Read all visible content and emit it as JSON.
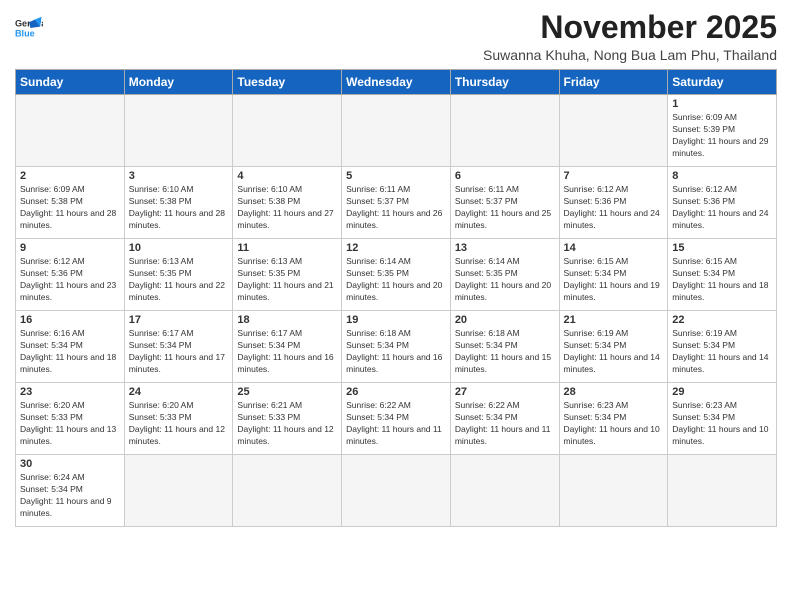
{
  "logo": {
    "line1": "General",
    "line2": "Blue"
  },
  "header": {
    "month_title": "November 2025",
    "subtitle": "Suwanna Khuha, Nong Bua Lam Phu, Thailand"
  },
  "weekdays": [
    "Sunday",
    "Monday",
    "Tuesday",
    "Wednesday",
    "Thursday",
    "Friday",
    "Saturday"
  ],
  "days": {
    "d1": {
      "num": "1",
      "sunrise": "6:09 AM",
      "sunset": "5:39 PM",
      "daylight": "11 hours and 29 minutes."
    },
    "d2": {
      "num": "2",
      "sunrise": "6:09 AM",
      "sunset": "5:38 PM",
      "daylight": "11 hours and 28 minutes."
    },
    "d3": {
      "num": "3",
      "sunrise": "6:10 AM",
      "sunset": "5:38 PM",
      "daylight": "11 hours and 28 minutes."
    },
    "d4": {
      "num": "4",
      "sunrise": "6:10 AM",
      "sunset": "5:38 PM",
      "daylight": "11 hours and 27 minutes."
    },
    "d5": {
      "num": "5",
      "sunrise": "6:11 AM",
      "sunset": "5:37 PM",
      "daylight": "11 hours and 26 minutes."
    },
    "d6": {
      "num": "6",
      "sunrise": "6:11 AM",
      "sunset": "5:37 PM",
      "daylight": "11 hours and 25 minutes."
    },
    "d7": {
      "num": "7",
      "sunrise": "6:12 AM",
      "sunset": "5:36 PM",
      "daylight": "11 hours and 24 minutes."
    },
    "d8": {
      "num": "8",
      "sunrise": "6:12 AM",
      "sunset": "5:36 PM",
      "daylight": "11 hours and 24 minutes."
    },
    "d9": {
      "num": "9",
      "sunrise": "6:12 AM",
      "sunset": "5:36 PM",
      "daylight": "11 hours and 23 minutes."
    },
    "d10": {
      "num": "10",
      "sunrise": "6:13 AM",
      "sunset": "5:35 PM",
      "daylight": "11 hours and 22 minutes."
    },
    "d11": {
      "num": "11",
      "sunrise": "6:13 AM",
      "sunset": "5:35 PM",
      "daylight": "11 hours and 21 minutes."
    },
    "d12": {
      "num": "12",
      "sunrise": "6:14 AM",
      "sunset": "5:35 PM",
      "daylight": "11 hours and 20 minutes."
    },
    "d13": {
      "num": "13",
      "sunrise": "6:14 AM",
      "sunset": "5:35 PM",
      "daylight": "11 hours and 20 minutes."
    },
    "d14": {
      "num": "14",
      "sunrise": "6:15 AM",
      "sunset": "5:34 PM",
      "daylight": "11 hours and 19 minutes."
    },
    "d15": {
      "num": "15",
      "sunrise": "6:15 AM",
      "sunset": "5:34 PM",
      "daylight": "11 hours and 18 minutes."
    },
    "d16": {
      "num": "16",
      "sunrise": "6:16 AM",
      "sunset": "5:34 PM",
      "daylight": "11 hours and 18 minutes."
    },
    "d17": {
      "num": "17",
      "sunrise": "6:17 AM",
      "sunset": "5:34 PM",
      "daylight": "11 hours and 17 minutes."
    },
    "d18": {
      "num": "18",
      "sunrise": "6:17 AM",
      "sunset": "5:34 PM",
      "daylight": "11 hours and 16 minutes."
    },
    "d19": {
      "num": "19",
      "sunrise": "6:18 AM",
      "sunset": "5:34 PM",
      "daylight": "11 hours and 16 minutes."
    },
    "d20": {
      "num": "20",
      "sunrise": "6:18 AM",
      "sunset": "5:34 PM",
      "daylight": "11 hours and 15 minutes."
    },
    "d21": {
      "num": "21",
      "sunrise": "6:19 AM",
      "sunset": "5:34 PM",
      "daylight": "11 hours and 14 minutes."
    },
    "d22": {
      "num": "22",
      "sunrise": "6:19 AM",
      "sunset": "5:34 PM",
      "daylight": "11 hours and 14 minutes."
    },
    "d23": {
      "num": "23",
      "sunrise": "6:20 AM",
      "sunset": "5:33 PM",
      "daylight": "11 hours and 13 minutes."
    },
    "d24": {
      "num": "24",
      "sunrise": "6:20 AM",
      "sunset": "5:33 PM",
      "daylight": "11 hours and 12 minutes."
    },
    "d25": {
      "num": "25",
      "sunrise": "6:21 AM",
      "sunset": "5:33 PM",
      "daylight": "11 hours and 12 minutes."
    },
    "d26": {
      "num": "26",
      "sunrise": "6:22 AM",
      "sunset": "5:34 PM",
      "daylight": "11 hours and 11 minutes."
    },
    "d27": {
      "num": "27",
      "sunrise": "6:22 AM",
      "sunset": "5:34 PM",
      "daylight": "11 hours and 11 minutes."
    },
    "d28": {
      "num": "28",
      "sunrise": "6:23 AM",
      "sunset": "5:34 PM",
      "daylight": "11 hours and 10 minutes."
    },
    "d29": {
      "num": "29",
      "sunrise": "6:23 AM",
      "sunset": "5:34 PM",
      "daylight": "11 hours and 10 minutes."
    },
    "d30": {
      "num": "30",
      "sunrise": "6:24 AM",
      "sunset": "5:34 PM",
      "daylight": "11 hours and 9 minutes."
    }
  }
}
